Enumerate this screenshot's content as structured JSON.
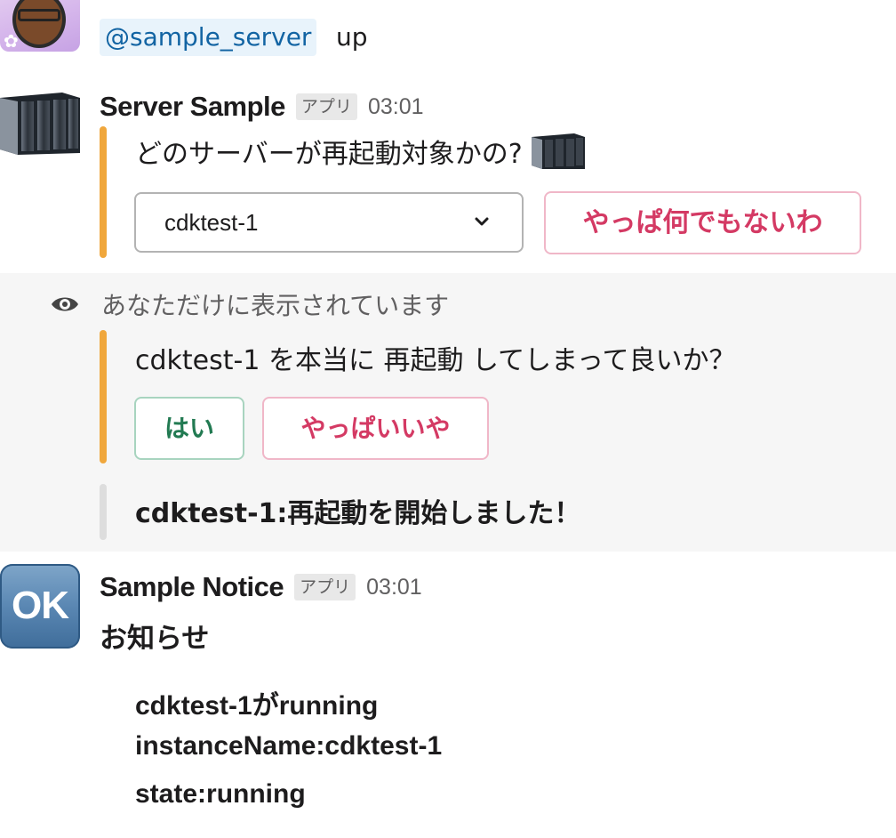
{
  "messages": {
    "first": {
      "mention": "@sample_server",
      "text": "up"
    },
    "server_sample": {
      "sender": "Server Sample",
      "badge": "アプリ",
      "time": "03:01",
      "question": "どのサーバーが再起動対象かの?",
      "select": {
        "value": "cdktest-1"
      },
      "cancel_button": "やっぱ何でもないわ"
    },
    "ephemeral": {
      "label": "あなただけに表示されています",
      "confirm_text": "cdktest-1 を本当に 再起動 してしまって良いか？",
      "yes_button": "はい",
      "no_button": "やっぱいいや",
      "result": "cdktest-1:再起動を開始しました！"
    },
    "sample_notice": {
      "sender": "Sample Notice",
      "badge": "アプリ",
      "time": "03:01",
      "avatar_text": "OK",
      "title": "お知らせ",
      "lines": [
        "cdktest-1がrunning",
        "instanceName:cdktest-1",
        "state:running"
      ]
    }
  },
  "colors": {
    "accent_bar": "#f0a73c",
    "result_bar": "#dddddd",
    "mention_bg": "#e8f3fb",
    "mention_text": "#1264a3",
    "danger": "#d43a64",
    "ok": "#227a52"
  },
  "icons": {
    "eye": "eye-icon",
    "chevron": "chevron-down-icon",
    "server": "server-rack-icon"
  }
}
